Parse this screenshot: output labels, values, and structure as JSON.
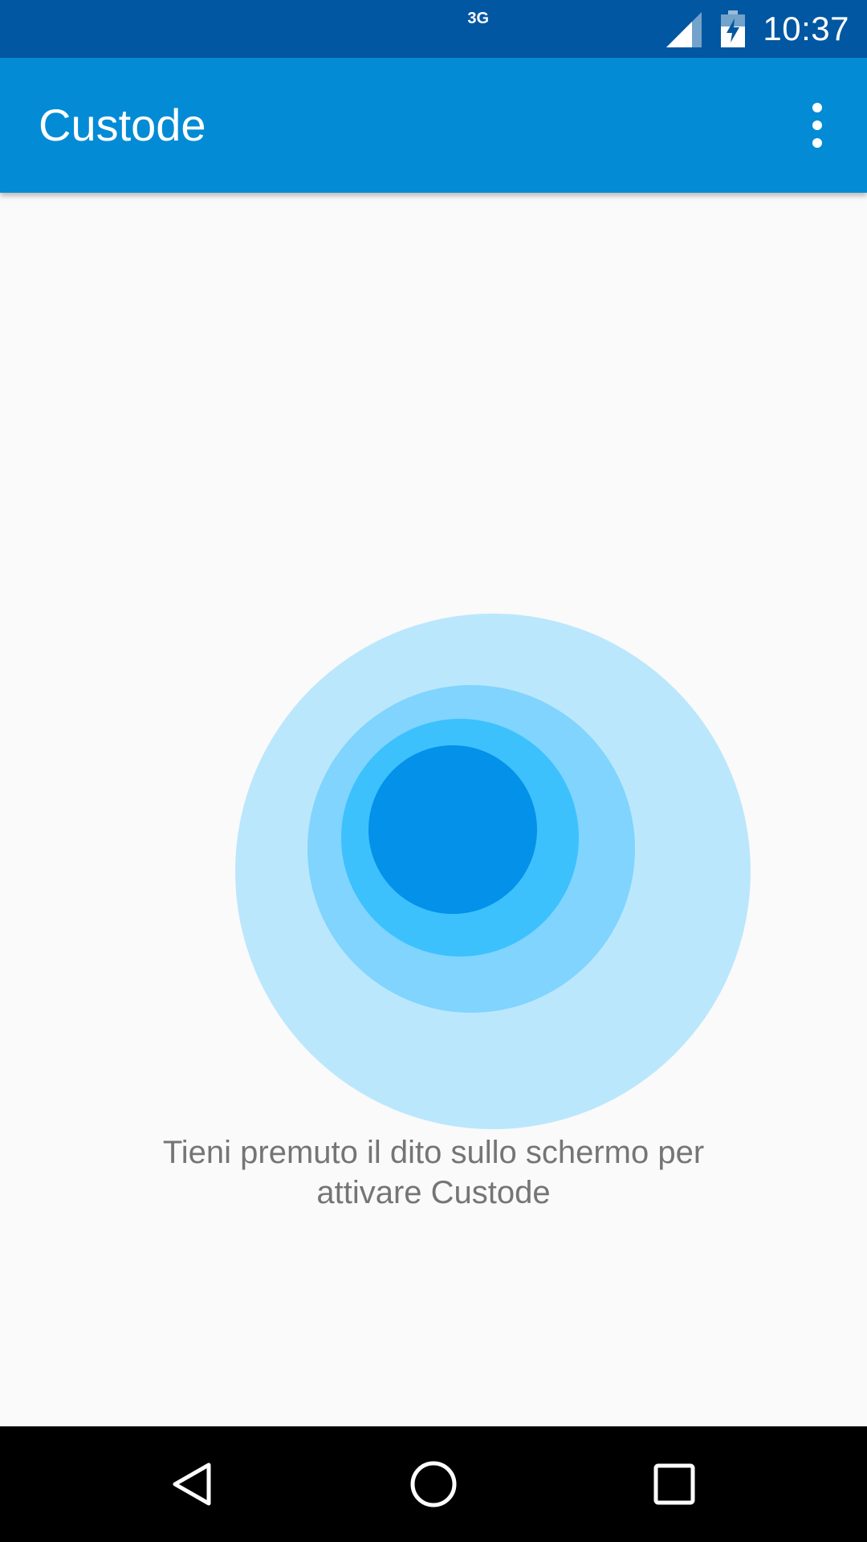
{
  "status_bar": {
    "network_type": "3G",
    "time": "10:37",
    "icons": [
      "signal-icon",
      "battery-charging-icon"
    ]
  },
  "app_bar": {
    "title": "Custode",
    "overflow_icon": "more-vert-icon"
  },
  "main": {
    "instruction_text": "Tieni premuto il dito sullo schermo per attivare Custode",
    "rings_colors": [
      "#bbe7fc",
      "#80d4fe",
      "#3cc1fd",
      "#0391e9"
    ]
  },
  "nav_bar": {
    "icons": [
      "back-icon",
      "home-icon",
      "recents-icon"
    ]
  },
  "colors": {
    "status_bar": "#0157a1",
    "app_bar": "#038bd5",
    "background": "#fafafa",
    "text_secondary": "#757575"
  }
}
